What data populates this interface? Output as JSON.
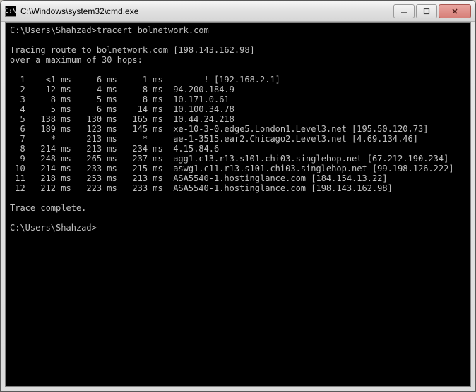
{
  "window": {
    "icon_label": "C:\\",
    "title": "C:\\Windows\\system32\\cmd.exe"
  },
  "controls": {
    "minimize_glyph": "—",
    "maximize_glyph": "▢",
    "close_glyph": "✕"
  },
  "prompt": {
    "path": "C:\\Users\\Shahzad>",
    "command": "tracert bolnetwork.com"
  },
  "tracing": {
    "line1": "Tracing route to bolnetwork.com [198.143.162.98]",
    "line2": "over a maximum of 30 hops:"
  },
  "hops": [
    {
      "n": "  1",
      "t1": "   <1 ms",
      "t2": "    6 ms",
      "t3": "    1 ms",
      "dest": "----- ! [192.168.2.1]"
    },
    {
      "n": "  2",
      "t1": "   12 ms",
      "t2": "    4 ms",
      "t3": "    8 ms",
      "dest": "94.200.184.9"
    },
    {
      "n": "  3",
      "t1": "    8 ms",
      "t2": "    5 ms",
      "t3": "    8 ms",
      "dest": "10.171.0.61"
    },
    {
      "n": "  4",
      "t1": "    5 ms",
      "t2": "    6 ms",
      "t3": "   14 ms",
      "dest": "10.100.34.78"
    },
    {
      "n": "  5",
      "t1": "  138 ms",
      "t2": "  130 ms",
      "t3": "  165 ms",
      "dest": "10.44.24.218"
    },
    {
      "n": "  6",
      "t1": "  189 ms",
      "t2": "  123 ms",
      "t3": "  145 ms",
      "dest": "xe-10-3-0.edge5.London1.Level3.net [195.50.120.73]"
    },
    {
      "n": "  7",
      "t1": "    *   ",
      "t2": "  213 ms",
      "t3": "    *   ",
      "dest": "ae-1-3515.ear2.Chicago2.Level3.net [4.69.134.46]"
    },
    {
      "n": "  8",
      "t1": "  214 ms",
      "t2": "  213 ms",
      "t3": "  234 ms",
      "dest": "4.15.84.6"
    },
    {
      "n": "  9",
      "t1": "  248 ms",
      "t2": "  265 ms",
      "t3": "  237 ms",
      "dest": "agg1.c13.r13.s101.chi03.singlehop.net [67.212.190.234]"
    },
    {
      "n": " 10",
      "t1": "  214 ms",
      "t2": "  233 ms",
      "t3": "  215 ms",
      "dest": "aswg1.c11.r13.s101.chi03.singlehop.net [99.198.126.222]"
    },
    {
      "n": " 11",
      "t1": "  218 ms",
      "t2": "  253 ms",
      "t3": "  213 ms",
      "dest": "ASA5540-1.hostinglance.com [184.154.13.22]"
    },
    {
      "n": " 12",
      "t1": "  212 ms",
      "t2": "  223 ms",
      "t3": "  233 ms",
      "dest": "ASA5540-1.hostinglance.com [198.143.162.98]"
    }
  ],
  "trace_complete": "Trace complete.",
  "prompt2": {
    "path": "C:\\Users\\Shahzad>"
  }
}
